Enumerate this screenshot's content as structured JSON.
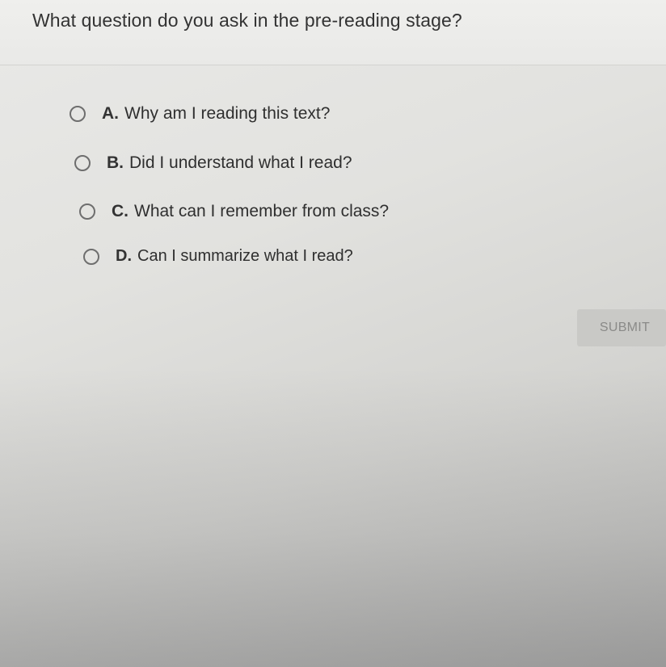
{
  "question": {
    "text": "What question do you ask in the pre-reading stage?"
  },
  "options": [
    {
      "letter": "A.",
      "text": "Why am I reading this text?"
    },
    {
      "letter": "B.",
      "text": "Did I understand what I read?"
    },
    {
      "letter": "C.",
      "text": "What can I remember from class?"
    },
    {
      "letter": "D.",
      "text": "Can I summarize what I read?"
    }
  ],
  "submit": {
    "label": "SUBMIT"
  }
}
